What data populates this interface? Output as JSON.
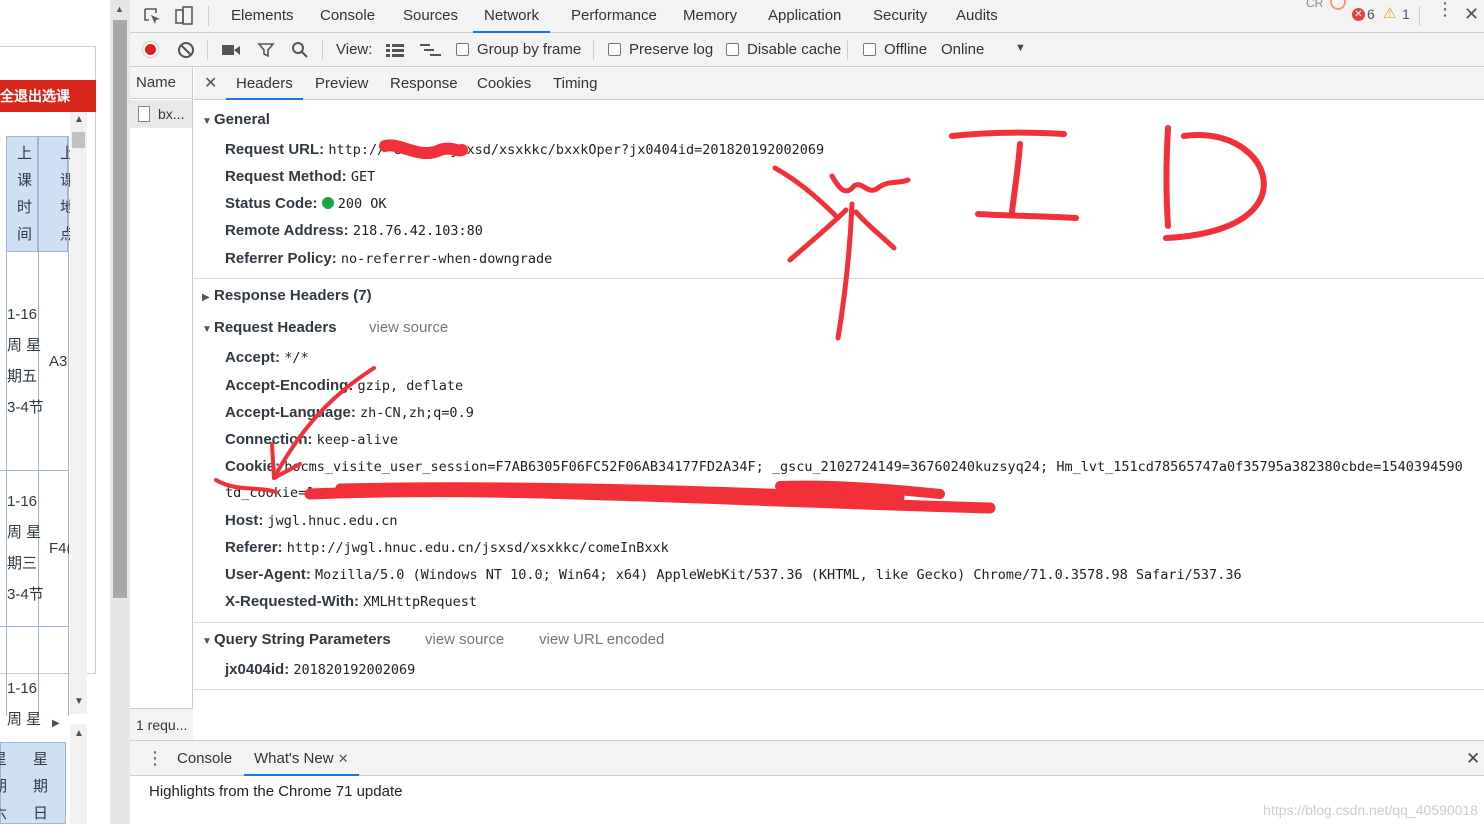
{
  "page": {
    "red_button": "安全退出选课",
    "header_cols": [
      [
        "上",
        "课",
        "时",
        "间"
      ],
      [
        "上",
        "课",
        "地",
        "点"
      ]
    ],
    "rows": [
      {
        "time_lines": [
          "1-16",
          "周 星",
          "期五",
          "3-4节"
        ],
        "place": "A3"
      },
      {
        "time_lines": [
          "1-16",
          "周 星",
          "期三",
          "3-4节"
        ],
        "place": "F4("
      },
      {
        "time_lines": [
          "1-16",
          "周 星"
        ],
        "place": ""
      }
    ],
    "bottom_cols": [
      [
        "星",
        "期",
        "六"
      ],
      [
        "星",
        "期",
        "日"
      ]
    ]
  },
  "devtools": {
    "tabs": [
      "Elements",
      "Console",
      "Sources",
      "Network",
      "Performance",
      "Memory",
      "Application",
      "Security",
      "Audits"
    ],
    "active_tab": "Network",
    "errors": "6",
    "warnings": "1",
    "cr_label": "CR",
    "toolbar": {
      "view_label": "View:",
      "group_by_frame": "Group by frame",
      "preserve_log": "Preserve log",
      "disable_cache": "Disable cache",
      "offline": "Offline",
      "online": "Online"
    },
    "name_col": {
      "header": "Name",
      "row": "bx...",
      "footer": "1 requ..."
    },
    "subtabs": [
      "Headers",
      "Preview",
      "Response",
      "Cookies",
      "Timing"
    ],
    "active_subtab": "Headers",
    "general": {
      "title": "General",
      "items": [
        {
          "k": "Request URL:",
          "v": "http://           edu.cn/jsxsd/xsxkkc/bxxkOper?jx0404id=201820192002069"
        },
        {
          "k": "Request Method:",
          "v": "GET"
        },
        {
          "k": "Status Code:",
          "v": "200 OK"
        },
        {
          "k": "Remote Address:",
          "v": "218.76.42.103:80"
        },
        {
          "k": "Referrer Policy:",
          "v": "no-referrer-when-downgrade"
        }
      ]
    },
    "response_headers": {
      "title": "Response Headers (7)"
    },
    "request_headers": {
      "title": "Request Headers",
      "view_source": "view source",
      "items": [
        {
          "k": "Accept:",
          "v": "*/*"
        },
        {
          "k": "Accept-Encoding:",
          "v": "gzip, deflate"
        },
        {
          "k": "Accept-Language:",
          "v": "zh-CN,zh;q=0.9"
        },
        {
          "k": "Connection:",
          "v": "keep-alive"
        },
        {
          "k": "Cookie:",
          "v": "bocms_visite_user_session=F7AB6305F06FC52F06AB34177FD2A34F; _gscu_2102724149=36760240kuzsyq24; Hm_lvt_151cd78565747a0f35795a382380cbde=1540394590"
        },
        {
          "k": "",
          "v": "td_cookie=1"
        },
        {
          "k": "Host:",
          "v": "jwgl.hnuc.edu.cn"
        },
        {
          "k": "Referer:",
          "v": "http://jwgl.hnuc.edu.cn/jsxsd/xsxkkc/comeInBxxk"
        },
        {
          "k": "User-Agent:",
          "v": "Mozilla/5.0 (Windows NT 10.0; Win64; x64) AppleWebKit/537.36 (KHTML, like Gecko) Chrome/71.0.3578.98 Safari/537.36"
        },
        {
          "k": "X-Requested-With:",
          "v": "XMLHttpRequest"
        }
      ]
    },
    "query_string": {
      "title": "Query String Parameters",
      "view_source": "view source",
      "view_url_encoded": "view URL encoded",
      "items": [
        {
          "k": "jx0404id:",
          "v": "201820192002069"
        }
      ]
    },
    "drawer": {
      "tabs": [
        "Console",
        "What's New"
      ],
      "active": "What's New",
      "message": "Highlights from the Chrome 71 update"
    }
  },
  "watermark": "https://blog.csdn.net/qq_40590018"
}
